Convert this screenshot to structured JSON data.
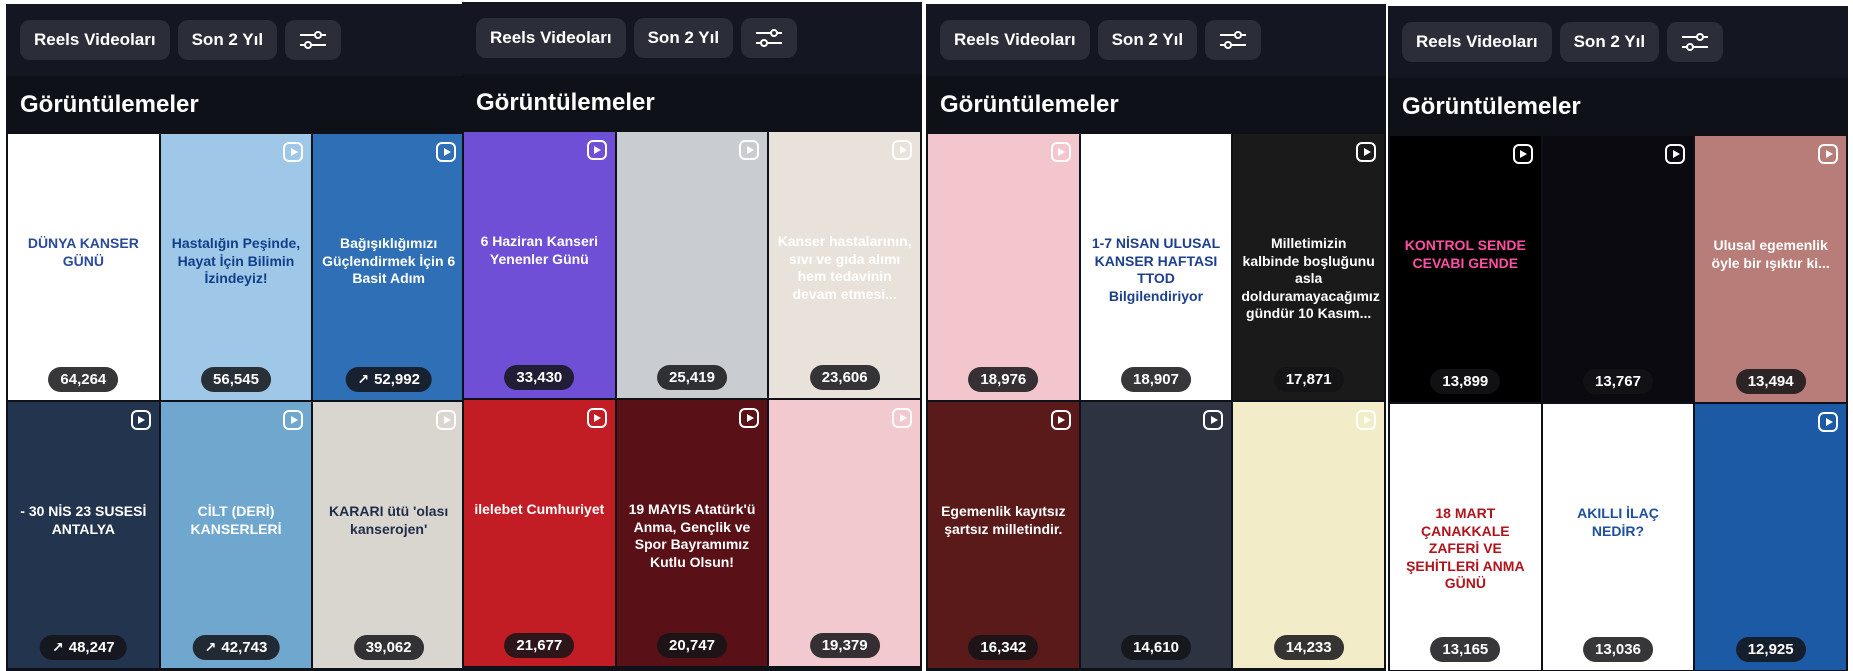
{
  "panels": [
    {
      "filters": {
        "type": "Reels Videoları",
        "period": "Son 2 Yıl"
      },
      "heading": "Görüntülemeler",
      "tiles": [
        {
          "views": "64,264",
          "trend": false,
          "caption": "DÜNYA KANSER GÜNÜ",
          "bg": "#ffffff",
          "fg": "#2a4a9a"
        },
        {
          "views": "56,545",
          "trend": false,
          "caption": "Hastalığın Peşinde, Hayat İçin Bilimin İzindeyiz!",
          "bg": "#9fc8e8",
          "fg": "#0f3f8a"
        },
        {
          "views": "52,992",
          "trend": true,
          "caption": "Bağışıklığımızı Güçlendirmek İçin 6 Basit Adım",
          "bg": "#2f6fb5",
          "fg": "#ffffff"
        },
        {
          "views": "48,247",
          "trend": true,
          "caption": "- 30 NİS 23 SUSESİ ANTALYA",
          "bg": "#23344f",
          "fg": "#ffffff"
        },
        {
          "views": "42,743",
          "trend": true,
          "caption": "CİLT (DERİ) KANSERLERİ",
          "bg": "#6fa7cf",
          "fg": "#ffffff"
        },
        {
          "views": "39,062",
          "trend": false,
          "caption": "KARARI ütü 'olası kanserojen'",
          "bg": "#d9d6d0",
          "fg": "#1f2d4a"
        }
      ]
    },
    {
      "filters": {
        "type": "Reels Videoları",
        "period": "Son 2 Yıl"
      },
      "heading": "Görüntülemeler",
      "tiles": [
        {
          "views": "33,430",
          "trend": false,
          "caption": "6 Haziran Kanseri Yenenler Günü",
          "bg": "#6e4fd6",
          "fg": "#ffffff"
        },
        {
          "views": "25,419",
          "trend": false,
          "caption": "",
          "bg": "#c9ccd0",
          "fg": "#222222"
        },
        {
          "views": "23,606",
          "trend": false,
          "caption": "Kanser hastalarının, sıvı ve gıda alımı hem tedavinin devam etmesi...",
          "bg": "#e9e2da",
          "fg": "#ffffff"
        },
        {
          "views": "21,677",
          "trend": false,
          "caption": "ilelebet Cumhuriyet",
          "bg": "#c21d25",
          "fg": "#ffffff"
        },
        {
          "views": "20,747",
          "trend": false,
          "caption": "19 MAYIS Atatürk'ü Anma, Gençlik ve Spor Bayramımız Kutlu Olsun!",
          "bg": "#5a1017",
          "fg": "#ffffff"
        },
        {
          "views": "19,379",
          "trend": false,
          "caption": "",
          "bg": "#f1c9cf",
          "fg": "#222222"
        }
      ]
    },
    {
      "filters": {
        "type": "Reels Videoları",
        "period": "Son 2 Yıl"
      },
      "heading": "Görüntülemeler",
      "tiles": [
        {
          "views": "18,976",
          "trend": false,
          "caption": "",
          "bg": "#f3c6cd",
          "fg": "#222222"
        },
        {
          "views": "18,907",
          "trend": false,
          "caption": "1-7 NİSAN ULUSAL KANSER HAFTASI TTOD Bilgilendiriyor",
          "bg": "#ffffff",
          "fg": "#1d3f8c"
        },
        {
          "views": "17,871",
          "trend": false,
          "caption": "Milletimizin kalbinde boşluğunu asla dolduramayacağımız gündür 10 Kasım...",
          "bg": "#1a1a1a",
          "fg": "#ffffff"
        },
        {
          "views": "16,342",
          "trend": false,
          "caption": "Egemenlik kayıtsız şartsız milletindir.",
          "bg": "#5a1a1a",
          "fg": "#ffffff"
        },
        {
          "views": "14,610",
          "trend": false,
          "caption": "",
          "bg": "#2d3340",
          "fg": "#ffffff"
        },
        {
          "views": "14,233",
          "trend": false,
          "caption": "",
          "bg": "#f3ecc8",
          "fg": "#222222"
        }
      ]
    },
    {
      "filters": {
        "type": "Reels Videoları",
        "period": "Son 2 Yıl"
      },
      "heading": "Görüntülemeler",
      "tiles": [
        {
          "views": "13,899",
          "trend": false,
          "caption": "KONTROL SENDE CEVABI GENDE",
          "bg": "#000000",
          "fg": "#ff4fa3"
        },
        {
          "views": "13,767",
          "trend": false,
          "caption": "",
          "bg": "#0a0a10",
          "fg": "#ffffff"
        },
        {
          "views": "13,494",
          "trend": false,
          "caption": "Ulusal egemenlik öyle bir ışıktır ki...",
          "bg": "#b87d78",
          "fg": "#ffffff"
        },
        {
          "views": "13,165",
          "trend": false,
          "caption": "18 MART ÇANAKKALE ZAFERİ VE ŞEHİTLERİ ANMA GÜNÜ",
          "bg": "#ffffff",
          "fg": "#b0141c"
        },
        {
          "views": "13,036",
          "trend": false,
          "caption": "AKILLI İLAÇ NEDİR?",
          "bg": "#ffffff",
          "fg": "#1d4f9c"
        },
        {
          "views": "12,925",
          "trend": false,
          "caption": "",
          "bg": "#1c5aa6",
          "fg": "#ffffff"
        }
      ]
    }
  ]
}
